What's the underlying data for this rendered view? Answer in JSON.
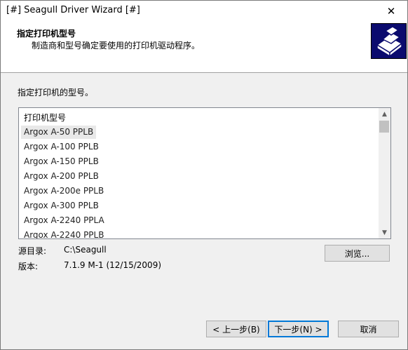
{
  "window": {
    "title": "[#] Seagull Driver Wizard [#]",
    "close_glyph": "✕"
  },
  "header": {
    "title": "指定打印机型号",
    "subtitle": "制造商和型号确定要使用的打印机驱动程序。",
    "icon": "printer-icon"
  },
  "main": {
    "instruction": "指定打印机的型号。",
    "list": {
      "header": "打印机型号",
      "items": [
        "Argox A-50 PPLB",
        "Argox A-100 PPLB",
        "Argox A-150 PPLB",
        "Argox A-200 PPLB",
        "Argox A-200e PPLB",
        "Argox A-300 PPLB",
        "Argox A-2240 PPLA",
        "Argox A-2240 PPLB"
      ],
      "selected_index": 0
    },
    "source_label": "源目录:",
    "source_value": "C:\\Seagull",
    "version_label": "版本:",
    "version_value": "7.1.9 M-1 (12/15/2009)",
    "browse_button": "浏览..."
  },
  "footer": {
    "back_button": "< 上一步(B)",
    "next_button": "下一步(N) >",
    "cancel_button": "取消"
  },
  "colors": {
    "header_icon_bg": "#0b0b6e",
    "default_button_border": "#0078d7"
  }
}
